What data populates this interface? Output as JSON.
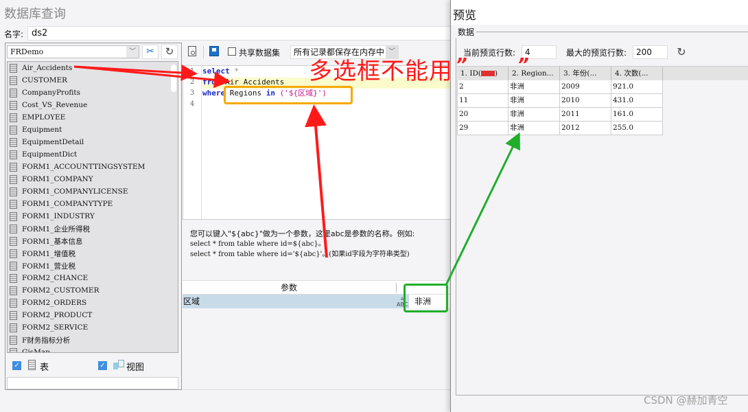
{
  "main": {
    "title": "数据库查询",
    "name_label": "名字:",
    "name_value": "ds2",
    "db_select": "FRDemo",
    "tables": [
      "Air_Accidents",
      "CUSTOMER",
      "CompanyProfits",
      "Cost_VS_Revenue",
      "EMPLOYEE",
      "Equipment",
      "EquipmentDetail",
      "EquipmentDict",
      "FORM1_ACCOUNTTINGSYSTEM",
      "FORM1_COMPANY",
      "FORM1_COMPANYLICENSE",
      "FORM1_COMPANYTYPE",
      "FORM1_INDUSTRY",
      "FORM1_企业所得税",
      "FORM1_基本信息",
      "FORM1_增值税",
      "FORM1_营业税",
      "FORM2_CHANCE",
      "FORM2_CUSTOMER",
      "FORM2_ORDERS",
      "FORM2_PRODUCT",
      "FORM2_SERVICE",
      "F财务指标分析",
      "GisMap"
    ],
    "filters": {
      "table_label": "表",
      "view_label": "视图",
      "table_checked": true,
      "view_checked": true
    },
    "toolbar": {
      "share_label": "共享数据集",
      "share_checked": false,
      "memory_select": "所有记录都保存在内存中"
    },
    "editor": {
      "line_numbers": [
        "1",
        "2",
        "3",
        "4"
      ],
      "lines": [
        [
          {
            "t": "select",
            "c": "kw"
          },
          {
            "t": " *",
            "c": "gray"
          }
        ],
        [
          {
            "t": "from",
            "c": "kw"
          },
          {
            "t": " Air_Accidents",
            "c": ""
          }
        ],
        [
          {
            "t": "where",
            "c": "kw"
          },
          {
            "t": " Regions ",
            "c": ""
          },
          {
            "t": "in",
            "c": "kw"
          },
          {
            "t": " (",
            "c": "str"
          },
          {
            "t": "'${区域}'",
            "c": "str"
          },
          {
            "t": ")",
            "c": "str"
          }
        ],
        []
      ]
    },
    "hint": {
      "line1": "您可以键入\"${abc}\"做为一个参数，这里abc是参数的名称。例如:",
      "line2": "select * from table where id=${abc}。",
      "line3": "select * from table where id='${abc}'。(如果id字段为字符串类型)"
    },
    "params": {
      "header": "参数",
      "rows": [
        {
          "name": "区域",
          "value": "非洲"
        }
      ]
    }
  },
  "preview": {
    "title": "预览",
    "group_label": "数据",
    "current_rows_label": "当前预览行数:",
    "current_rows_value": "4",
    "max_rows_label": "最大的预览行数:",
    "max_rows_value": "200",
    "columns": [
      "1. ID(",
      "2. Region...",
      "3. 年份(...",
      "4. 次数(..."
    ],
    "rows": [
      [
        "2",
        "非洲",
        "2009",
        "921.0"
      ],
      [
        "11",
        "非洲",
        "2010",
        "431.0"
      ],
      [
        "20",
        "非洲",
        "2011",
        "161.0"
      ],
      [
        "29",
        "非洲",
        "2012",
        "255.0"
      ]
    ]
  },
  "annotation": {
    "text": "多选框不能用",
    "quote_open": "”",
    "quote_close": "”",
    "colors": {
      "red": "#ff1a1a",
      "orange": "#f5a800",
      "green": "#1fae2a"
    }
  },
  "watermark": "CSDN @赫加青空"
}
